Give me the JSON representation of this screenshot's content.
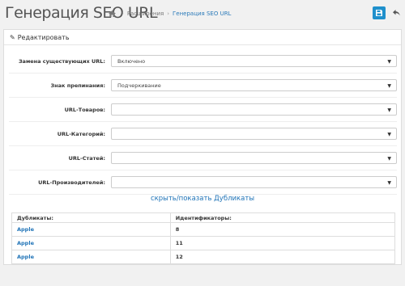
{
  "header": {
    "title": "Генерация SEO URL",
    "breadcrumbs": [
      "Расширения",
      "Генерация SEO URL"
    ]
  },
  "panel": {
    "heading": "Редактировать"
  },
  "form": {
    "fields": [
      {
        "label": "Замена существующих URL:",
        "value": "Включено"
      },
      {
        "label": "Знак препинания:",
        "value": "Подчеркивание"
      },
      {
        "label": "URL-Товаров:",
        "value": ""
      },
      {
        "label": "URL-Категорий:",
        "value": ""
      },
      {
        "label": "URL-Статей:",
        "value": ""
      },
      {
        "label": "URL-Производителей:",
        "value": ""
      }
    ]
  },
  "duplicates": {
    "toggle": "скрыть/показать Дубликаты",
    "headers": [
      "Дубликаты:",
      "Идентификаторы:"
    ],
    "rows": [
      {
        "name": "Apple",
        "id": "8"
      },
      {
        "name": "Apple",
        "id": "11"
      },
      {
        "name": "Apple",
        "id": "12"
      }
    ]
  },
  "colors": {
    "primary": "#1f90cc",
    "link": "#1f73b7"
  }
}
